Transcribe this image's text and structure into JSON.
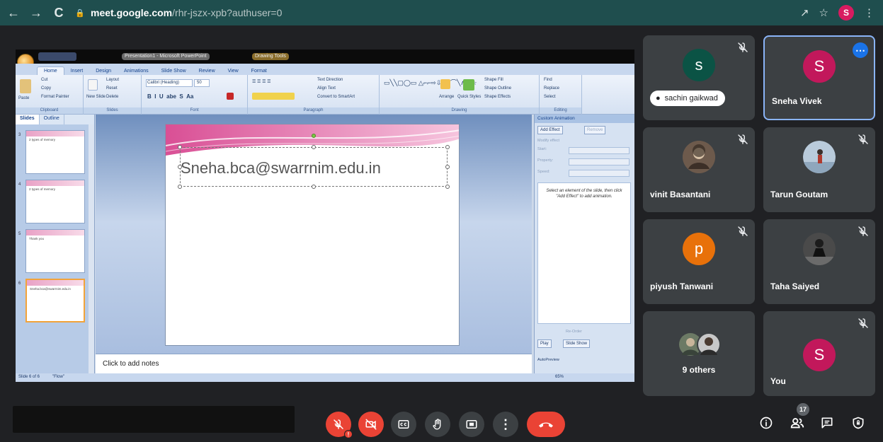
{
  "browser": {
    "url_host": "meet.google.com",
    "url_path": "/rhr-jszx-xpb?authuser=0",
    "profile_initial": "S"
  },
  "presentation": {
    "title_left": "Presentation1 - Microsoft PowerPoint",
    "title_tool": "Drawing Tools",
    "ribbon_tabs": [
      "Home",
      "Insert",
      "Design",
      "Animations",
      "Slide Show",
      "Review",
      "View",
      "Format"
    ],
    "ribbon_groups": [
      "Clipboard",
      "Slides",
      "Font",
      "Paragraph",
      "Drawing",
      "Editing"
    ],
    "ribbon_items": {
      "paste": "Paste",
      "cut": "Cut",
      "copy": "Copy",
      "format_painter": "Format Painter",
      "new_slide": "New Slide",
      "layout": "Layout",
      "reset": "Reset",
      "delete": "Delete",
      "font": "Calibri (Heading)",
      "font_size": "50",
      "text_direction": "Text Direction",
      "align_text": "Align Text",
      "convert_smartart": "Convert to SmartArt",
      "arrange": "Arrange",
      "quick_styles": "Quick Styles",
      "shape_fill": "Shape Fill",
      "shape_outline": "Shape Outline",
      "shape_effects": "Shape Effects",
      "find": "Find",
      "replace": "Replace",
      "select": "Select"
    },
    "panel_tabs": [
      "Slides",
      "Outline"
    ],
    "thumbnails": [
      {
        "num": "3",
        "text": "2 types of memory"
      },
      {
        "num": "4",
        "text": "2 types of memory"
      },
      {
        "num": "5",
        "text": "Thank you"
      },
      {
        "num": "6",
        "text": "Sneha.bca@swarrnim.edu.in"
      }
    ],
    "slide_text": "Sneha.bca@swarrnim.edu.in",
    "notes_placeholder": "Click to add notes",
    "status_slide": "Slide 6 of 6",
    "status_theme": "\"Flow\"",
    "zoom": "65%",
    "anim_panel": {
      "title": "Custom Animation",
      "add_effect": "Add Effect",
      "remove": "Remove",
      "modify": "Modify effect",
      "start": "Start:",
      "property": "Property:",
      "speed": "Speed:",
      "hint": "Select an element of the slide, then click \"Add Effect\" to add animation.",
      "reorder": "Re-Order",
      "play": "Play",
      "slide_show": "Slide Show",
      "autopreview": "AutoPreview"
    }
  },
  "participants": [
    {
      "name": "sachin gaikwad",
      "initial": "s",
      "color": "#0b5345",
      "type": "chip",
      "muted": true
    },
    {
      "name": "Sneha Vivek",
      "initial": "S",
      "color": "#c2185b",
      "type": "active",
      "muted": false
    },
    {
      "name": "vinit Basantani",
      "initial": "",
      "color": "#7b6a5c",
      "type": "photo",
      "muted": true
    },
    {
      "name": "Tarun Goutam",
      "initial": "",
      "color": "#9fb4c8",
      "type": "photo",
      "muted": true
    },
    {
      "name": "piyush Tanwani",
      "initial": "p",
      "color": "#e8710a",
      "type": "letter",
      "muted": true
    },
    {
      "name": "Taha Saiyed",
      "initial": "",
      "color": "#5a5a5a",
      "type": "photo",
      "muted": true
    },
    {
      "name": "9 others",
      "initial": "",
      "color": "#555",
      "type": "others",
      "muted": false
    },
    {
      "name": "You",
      "initial": "S",
      "color": "#c2185b",
      "type": "you",
      "muted": true
    }
  ],
  "toolbar": {
    "people_count": "17"
  }
}
